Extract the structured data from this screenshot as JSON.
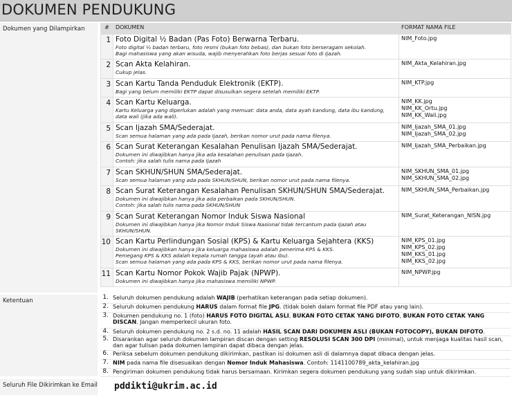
{
  "page_title": "DOKUMEN PENDUKUNG",
  "labels": {
    "dokumen": "Dokumen yang Dilampirkan",
    "ketentuan": "Ketentuan",
    "email": "Seluruh File Dikirimkan ke Email"
  },
  "table": {
    "col_no": "#",
    "col_doc": "DOKUMEN",
    "col_fmt": "FORMAT NAMA FILE"
  },
  "documents": [
    {
      "no": "1",
      "title": "Foto Digital ½ Badan (Pas Foto) Berwarna Terbaru.",
      "desc": [
        "Foto digital ½ badan terbaru, foto resmi (bukan foto bebas), dan bukan foto berseragam sekolah.",
        "Bagi mahasiswa yang akan wisuda, wajib menyerahkan foto berjas sesuai foto di Ijazah."
      ],
      "files": [
        "NIM_Foto.jpg"
      ]
    },
    {
      "no": "2",
      "title": "Scan Akta Kelahiran.",
      "desc": [
        "Cukup jelas."
      ],
      "files": [
        "NIM_Akta_Kelahiran.jpg"
      ]
    },
    {
      "no": "3",
      "title": "Scan Kartu Tanda Penduduk Elektronik (EKTP).",
      "desc": [
        "Bagi yang belum memiliki EKTP dapat disusulkan segera setelah memiliki EKTP."
      ],
      "files": [
        "NIM_KTP.jpg"
      ]
    },
    {
      "no": "4",
      "title": "Scan Kartu Keluarga.",
      "desc": [
        "Kartu Keluarga yang diperlukan adalah yang memuat: data anda, data ayah kandung, data ibu kandung, data wali (jika ada wali)."
      ],
      "files": [
        "NIM_KK.jpg",
        "NIM_KK_Ortu.jpg",
        "NIM_KK_Wali.jpg"
      ]
    },
    {
      "no": "5",
      "title": "Scan Ijazah SMA/Sederajat.",
      "desc": [
        "Scan semua halaman yang ada pada Ijazah, berikan nomor urut pada nama filenya."
      ],
      "files": [
        "NIM_Ijazah_SMA_01.jpg",
        "NIM_Ijazah_SMA_02.jpg"
      ]
    },
    {
      "no": "6",
      "title": "Scan Surat Keterangan Kesalahan Penulisan Ijazah SMA/Sederajat.",
      "desc": [
        "Dokumen ini diwajibkan hanya jika ada kesalahan penulisan pada Ijazah.",
        "Contoh: jika salah tulis nama pada Ijazah"
      ],
      "files": [
        "NIM_Ijazah_SMA_Perbaikan.jpg"
      ]
    },
    {
      "no": "7",
      "title": "Scan SKHUN/SHUN SMA/Sederajat.",
      "desc": [
        "Scan semua halaman yang ada pada SKHUN/SHUN, berikan nomor urut pada nama filenya."
      ],
      "files": [
        "NIM_SKHUN_SMA_01.jpg",
        "NIM_SKHUN_SMA_02.jpg"
      ]
    },
    {
      "no": "8",
      "title": "Scan Surat Keterangan Kesalahan Penulisan SKHUN/SHUN SMA/Sederajat.",
      "desc": [
        "Dokumen ini diwajibkan hanya jika ada perbaikan pada SKHUN/SHUN.",
        "Contoh: jika salah tulis nama pada SKHUN/SHUN"
      ],
      "files": [
        "NIM_SKHUN_SMA_Perbaikan.jpg"
      ]
    },
    {
      "no": "9",
      "title": "Scan Surat Keterangan Nomor Induk Siswa Nasional",
      "desc": [
        "Dokumen ini diwajibkan hanya jika Nomor Induk Siswa Nasional tidak tercantum pada Ijazah atau SKHUN/SHUN."
      ],
      "files": [
        "NIM_Surat_Keterangan_NISN.jpg"
      ]
    },
    {
      "no": "10",
      "title": "Scan Kartu Perlindungan Sosial (KPS) & Kartu Keluarga Sejahtera (KKS)",
      "desc": [
        "Dokumen ini diwajibkan hanya jika keluarga mahasiswa adalah penerima KPS & KKS.",
        "Pemegang KPS & KKS adalah kepala rumah tangga (ayah atau ibu).",
        "Scan semua halaman yang ada pada KPS & KKS, berikan nomor urut pada nama filenya."
      ],
      "files": [
        "NIM_KPS_01.jpg",
        "NIM_KPS_02.jpg",
        "NIM_KKS_01.jpg",
        "NIM_KKS_02.jpg"
      ]
    },
    {
      "no": "11",
      "title": "Scan Kartu Nomor Pokok Wajib Pajak (NPWP).",
      "desc": [
        "Dokumen ini diwajibkan hanya jika mahasiswa memiliki NPWP."
      ],
      "files": [
        "NIM_NPWP.jpg"
      ]
    }
  ],
  "rules": [
    {
      "no": "1.",
      "parts": [
        [
          "Seluruh dokumen pendukung adalah ",
          false
        ],
        [
          "WAJIB",
          true
        ],
        [
          " (perhatikan keterangan pada setiap dokumen).",
          false
        ]
      ]
    },
    {
      "no": "2.",
      "parts": [
        [
          "Seluruh dokumen pendukung ",
          false
        ],
        [
          "HARUS",
          true
        ],
        [
          " dalam format file ",
          false
        ],
        [
          "JPG",
          true
        ],
        [
          ". (tidak boleh dalam format file PDF atau yang lain).",
          false
        ]
      ]
    },
    {
      "no": "3.",
      "parts": [
        [
          "Dokumen pendukung no. 1 (foto) ",
          false
        ],
        [
          "HARUS FOTO DIGITAL ASLI",
          true
        ],
        [
          ", ",
          false
        ],
        [
          "BUKAN FOTO CETAK YANG DIFOTO",
          true
        ],
        [
          ", ",
          false
        ],
        [
          "BUKAN FOTO CETAK YANG DISCAN",
          true
        ],
        [
          ". Jangan memperkecil ukuran foto.",
          false
        ]
      ]
    },
    {
      "no": "4.",
      "parts": [
        [
          "Seluruh dokumen pendukung no. 2 s.d. no. 11 adalah ",
          false
        ],
        [
          "HASIL SCAN DARI DOKUMEN ASLI (BUKAN FOTOCOPY), BUKAN DIFOTO",
          true
        ],
        [
          ".",
          false
        ]
      ]
    },
    {
      "no": "5.",
      "parts": [
        [
          "Disarankan agar seluruh dokumen lampiran discan dengan setting ",
          false
        ],
        [
          "RESOLUSI SCAN 300 DPI",
          true
        ],
        [
          " (minimal), untuk menjaga kualitas hasil scan, dan agar tulisan pada dokumen lampiran dapat dibaca dengan jelas.",
          false
        ]
      ]
    },
    {
      "no": "6.",
      "parts": [
        [
          "Periksa sebelum dokumen pendukung dikirimkan, pastikan isi dokumen asli di dalamnya dapat dibaca dengan jelas.",
          false
        ]
      ]
    },
    {
      "no": "7.",
      "parts": [
        [
          "NIM",
          true
        ],
        [
          " pada nama file disesuaikan dengan ",
          false
        ],
        [
          "Nomor Induk Mahasiswa",
          true
        ],
        [
          ". Contoh: 1141100789_akta_kelahiran.jpg",
          false
        ]
      ]
    },
    {
      "no": "8.",
      "parts": [
        [
          "Pengiriman dokumen pendukung tidak harus bersamaan. Kirimkan segera dokumen pendukung yang sudah siap untuk dikirimkan.",
          false
        ]
      ]
    }
  ],
  "email": "pddikti@ukrim.ac.id"
}
